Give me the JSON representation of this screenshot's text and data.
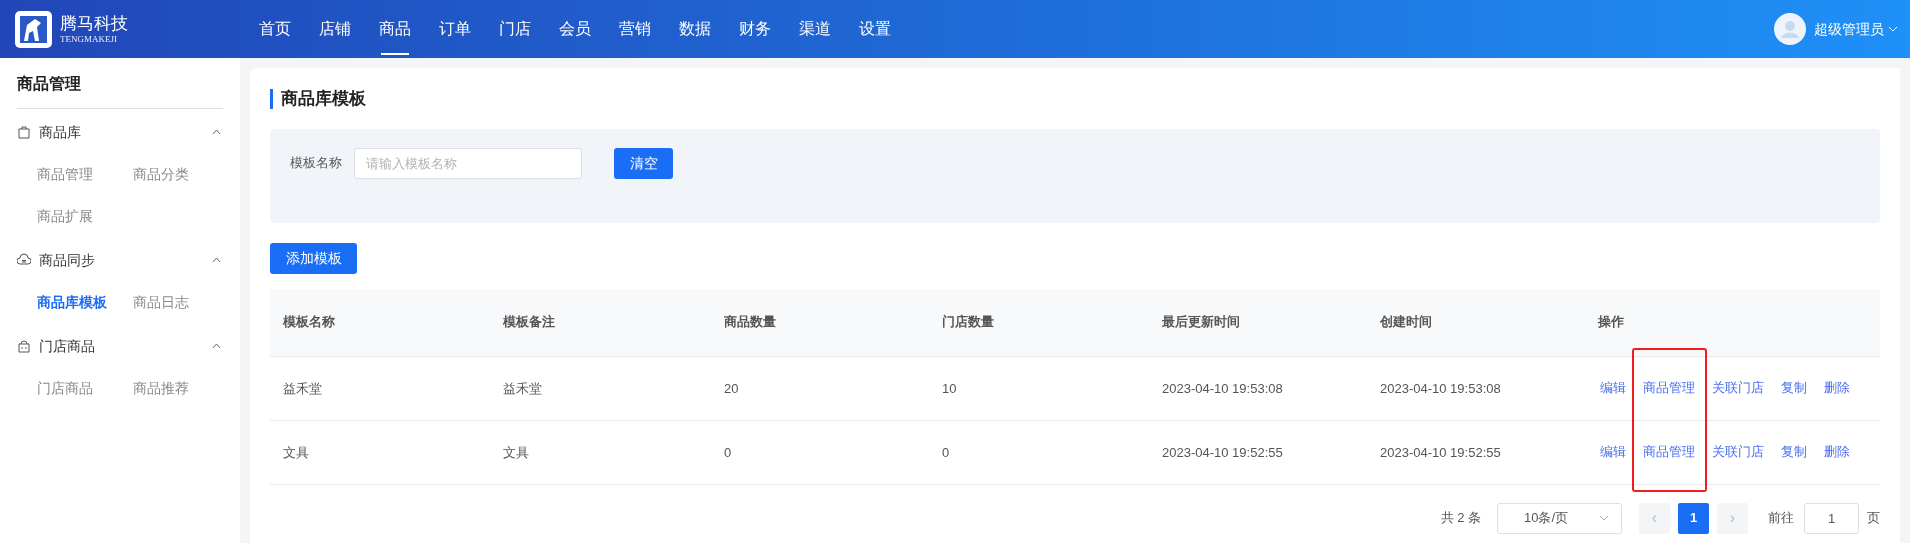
{
  "brand": {
    "name": "腾马科技",
    "subtitle": "TENGMAKEJI"
  },
  "nav": [
    {
      "label": "首页",
      "selected": false
    },
    {
      "label": "店铺",
      "selected": false
    },
    {
      "label": "商品",
      "selected": true
    },
    {
      "label": "订单",
      "selected": false
    },
    {
      "label": "门店",
      "selected": false
    },
    {
      "label": "会员",
      "selected": false
    },
    {
      "label": "营销",
      "selected": false
    },
    {
      "label": "数据",
      "selected": false
    },
    {
      "label": "财务",
      "selected": false
    },
    {
      "label": "渠道",
      "selected": false
    },
    {
      "label": "设置",
      "selected": false
    }
  ],
  "user": {
    "name": "超级管理员"
  },
  "sidebar": {
    "title": "商品管理",
    "groups": [
      {
        "label": "商品库",
        "expanded": true,
        "items": [
          {
            "label": "商品管理",
            "selected": false
          },
          {
            "label": "商品分类",
            "selected": false
          },
          {
            "label": "商品扩展",
            "selected": false
          }
        ]
      },
      {
        "label": "商品同步",
        "expanded": true,
        "items": [
          {
            "label": "商品库模板",
            "selected": true
          },
          {
            "label": "商品日志",
            "selected": false
          }
        ]
      },
      {
        "label": "门店商品",
        "expanded": true,
        "items": [
          {
            "label": "门店商品",
            "selected": false
          },
          {
            "label": "商品推荐",
            "selected": false
          }
        ]
      }
    ]
  },
  "page_title": "商品库模板",
  "filter": {
    "label": "模板名称",
    "placeholder": "请输入模板名称",
    "button": "清空"
  },
  "add_button": "添加模板",
  "table": {
    "columns": [
      "模板名称",
      "模板备注",
      "商品数量",
      "门店数量",
      "最后更新时间",
      "创建时间",
      "操作"
    ],
    "rows": [
      {
        "cells": [
          "益禾堂",
          "益禾堂",
          "20",
          "10",
          "2023-04-10 19:53:08",
          "2023-04-10 19:53:08"
        ],
        "actions": [
          {
            "label": "编辑",
            "highlighted": false
          },
          {
            "label": "商品管理",
            "highlighted": true
          },
          {
            "label": "关联门店",
            "highlighted": false
          },
          {
            "label": "复制",
            "highlighted": false
          },
          {
            "label": "删除",
            "highlighted": false
          }
        ]
      },
      {
        "cells": [
          "文具",
          "文具",
          "0",
          "0",
          "2023-04-10 19:52:55",
          "2023-04-10 19:52:55"
        ],
        "actions": [
          {
            "label": "编辑",
            "highlighted": false
          },
          {
            "label": "商品管理",
            "highlighted": true
          },
          {
            "label": "关联门店",
            "highlighted": false
          },
          {
            "label": "复制",
            "highlighted": false
          },
          {
            "label": "删除",
            "highlighted": false
          }
        ]
      }
    ]
  },
  "pagination": {
    "total": "共 2 条",
    "page_size": "10条/页",
    "prev": "‹",
    "pages": [
      {
        "label": "1",
        "selected": true
      }
    ],
    "next": "›",
    "goto_label": "前往",
    "goto_value": "1",
    "goto_suffix": "页"
  }
}
